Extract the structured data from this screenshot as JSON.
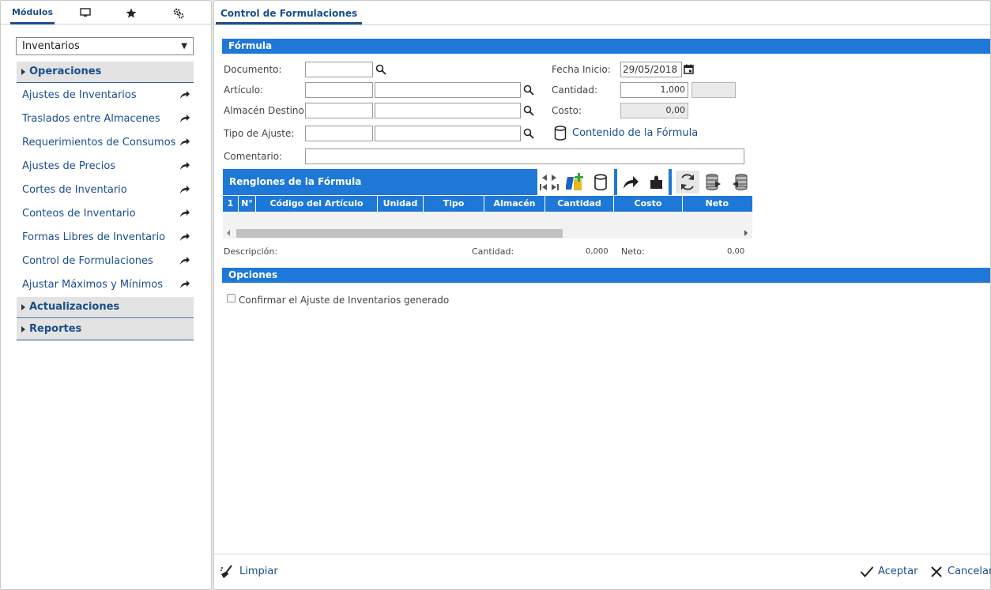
{
  "left_panel": {
    "tabs": {
      "modules_label": "Módulos",
      "icons": [
        "monitor-icon",
        "star-icon",
        "gears-icon"
      ]
    },
    "module_select": {
      "value": "Inventarios"
    },
    "groups": {
      "operaciones": "Operaciones",
      "actualizaciones": "Actualizaciones",
      "reportes": "Reportes"
    },
    "items": [
      "Ajustes de Inventarios",
      "Traslados entre Almacenes",
      "Requerimientos de Consumos",
      "Ajustes de Precios",
      "Cortes de Inventario",
      "Conteos de Inventario",
      "Formas Libres de Inventario",
      "Control de Formulaciones",
      "Ajustar Máximos y Mínimos"
    ]
  },
  "main": {
    "tab_title": "Control de Formulaciones",
    "formula_section": "Fórmula",
    "labels": {
      "documento": "Documento:",
      "articulo": "Artículo:",
      "almacen": "Almacén Destino:",
      "tipo_ajuste": "Tipo de Ajuste:",
      "comentario": "Comentario:",
      "fecha_inicio": "Fecha Inicio:",
      "cantidad": "Cantidad:",
      "costo": "Costo:"
    },
    "values": {
      "fecha_inicio": "29/05/2018",
      "cantidad": "1,000",
      "costo": "0,00"
    },
    "contenido_link": "Contenido de la Fórmula",
    "grid": {
      "title": "Renglones de la Fórmula",
      "columns": [
        "1",
        "N°",
        "Código del Artículo",
        "Unidad",
        "Tipo",
        "Almacén",
        "Cantidad",
        "Costo",
        "Neto"
      ]
    },
    "summary": {
      "descripcion_label": "Descripción:",
      "cantidad_label": "Cantidad:",
      "cantidad_value": "0,000",
      "neto_label": "Neto:",
      "neto_value": "0,00"
    },
    "options_section": "Opciones",
    "confirm_checkbox_label": "Confirmar el Ajuste de Inventarios generado",
    "footer": {
      "limpiar": "Limpiar",
      "aceptar": "Aceptar",
      "cancelar": "Cancelar"
    },
    "accent_color": "#1e78d7"
  }
}
